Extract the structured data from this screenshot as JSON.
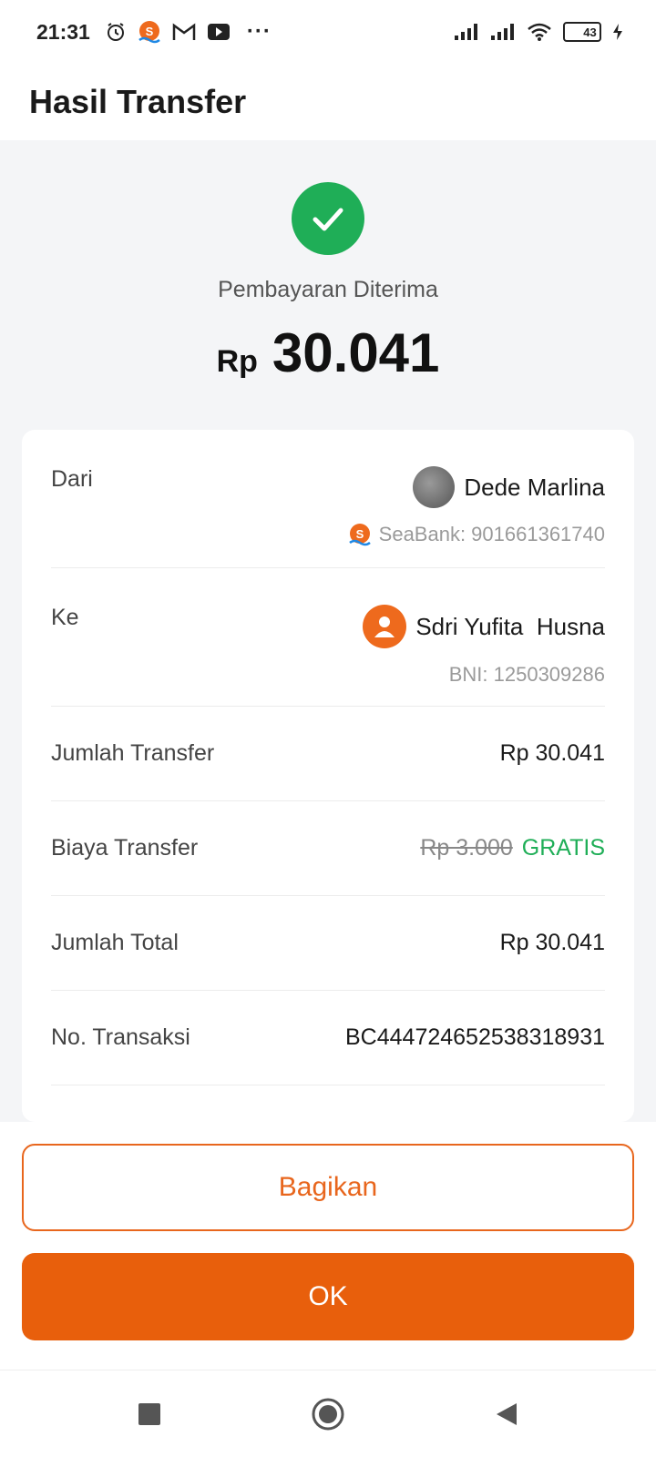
{
  "status_bar": {
    "time": "21:31",
    "battery_level": "43",
    "left_icons": [
      "alarm-icon",
      "seabank-icon",
      "gmail-icon",
      "youtube-icon",
      "more-dots-icon"
    ],
    "right_icons": [
      "signal-icon",
      "signal-icon",
      "wifi-icon",
      "battery-icon",
      "charging-icon"
    ],
    "more_dots": "···"
  },
  "header": {
    "title": "Hasil Transfer"
  },
  "result": {
    "status": "Pembayaran Diterima",
    "currency": "Rp",
    "amount": "30.041",
    "status_color": "#1fae57"
  },
  "details": {
    "from": {
      "label": "Dari",
      "name": "Dede Marlina",
      "account": "SeaBank: 901661361740"
    },
    "to": {
      "label": "Ke",
      "name": "Sdri Yufita  Husna",
      "account": "BNI: 1250309286"
    },
    "transfer_amount": {
      "label": "Jumlah Transfer",
      "value": "Rp 30.041"
    },
    "fee": {
      "label": "Biaya Transfer",
      "original": "Rp 3.000",
      "value": "GRATIS"
    },
    "total": {
      "label": "Jumlah Total",
      "value": "Rp 30.041"
    },
    "transaction_no": {
      "label": "No. Transaksi",
      "value": "BC444724652538318931"
    }
  },
  "actions": {
    "share_label": "Bagikan",
    "ok_label": "OK",
    "accent_color": "#e85f0c"
  },
  "nav": {
    "icons": [
      "recent-apps-icon",
      "home-icon",
      "back-icon"
    ]
  }
}
